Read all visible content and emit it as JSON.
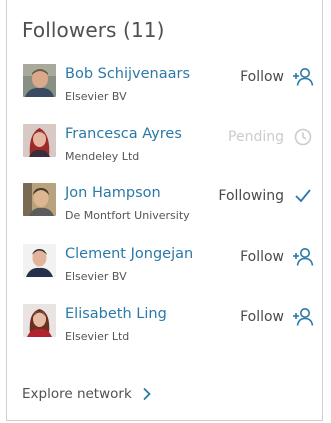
{
  "panel": {
    "title": "Followers (11)"
  },
  "users": [
    {
      "name": "Bob Schijvenaars",
      "org": "Elsevier BV",
      "action": "Follow",
      "action_icon": "add-person-icon"
    },
    {
      "name": "Francesca Ayres",
      "org": "Mendeley Ltd",
      "action": "Pending",
      "action_icon": "clock-icon"
    },
    {
      "name": "Jon Hampson",
      "org": "De Montfort University",
      "action": "Following",
      "action_icon": "checkmark-icon"
    },
    {
      "name": "Clement Jongejan",
      "org": "Elsevier BV",
      "action": "Follow",
      "action_icon": "add-person-icon"
    },
    {
      "name": "Elisabeth Ling",
      "org": "Elsevier Ltd",
      "action": "Follow",
      "action_icon": "add-person-icon"
    }
  ],
  "footer": {
    "link_label": "Explore network",
    "link_icon": "chevron-right-icon"
  },
  "colors": {
    "name_link": "#2b79a8",
    "icon_accent": "#2b79a8",
    "pending_text": "#cccccc"
  }
}
